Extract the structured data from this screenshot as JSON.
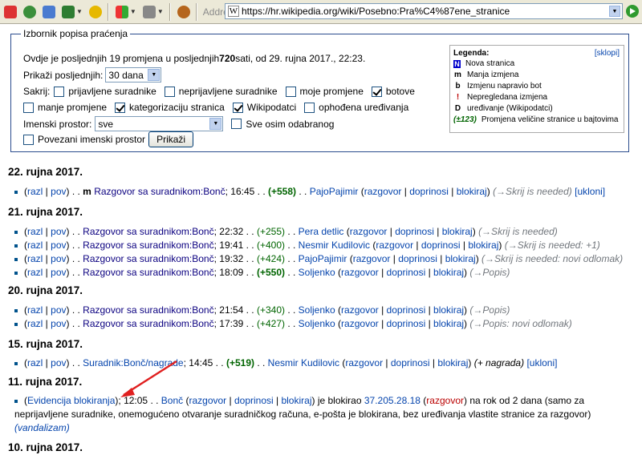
{
  "browser": {
    "address_label": "Address",
    "url": "https://hr.wikipedia.org/wiki/Posebno:Pra%C4%87ene_stranice"
  },
  "options": {
    "legend": "Izbornik popisa praćenja",
    "summary_pre": "Ovdje je posljednjih 19 promjena u posljednjih ",
    "summary_hours": "720",
    "summary_post": " sati, od 29. rujna 2017., 22:23.",
    "show_last_label": "Prikaži posljednjih:",
    "show_last_value": "30 dana",
    "hide_label": "Sakrij:",
    "cb_registered": "prijavljene suradnike",
    "cb_unregistered": "neprijavljene suradnike",
    "cb_mine": "moje promjene",
    "cb_bots": "botove",
    "cb_minor": "manje promjene",
    "cb_categorization": "kategorizaciju stranica",
    "cb_wikidata": "Wikipodatci",
    "cb_patrolled": "ophođena uređivanja",
    "namespace_label": "Imenski prostor:",
    "namespace_value": "sve",
    "invert_label": "Sve osim odabranog",
    "associated_label": "Povezani imenski prostor",
    "submit_label": "Prikaži"
  },
  "legend_box": {
    "title": "Legenda:",
    "hide": "[sklopi]",
    "items": [
      {
        "key": "N",
        "text": "Nova stranica"
      },
      {
        "key": "m",
        "text": "Manja izmjena"
      },
      {
        "key": "b",
        "text": "Izmjenu napravio bot"
      },
      {
        "key": "!",
        "text": "Nepregledana izmjena"
      },
      {
        "key": "D",
        "text": "uređivanje (Wikipodatci)"
      },
      {
        "key": "(±123)",
        "text": "Promjena veličine stranice u bajtovima"
      }
    ]
  },
  "days": [
    {
      "date": "22. rujna 2017."
    },
    {
      "date": "21. rujna 2017."
    },
    {
      "date": "20. rujna 2017."
    },
    {
      "date": "15. rujna 2017."
    },
    {
      "date": "11. rujna 2017."
    },
    {
      "date": "10. rujna 2017."
    }
  ],
  "links": {
    "razl": "razl",
    "pov": "pov",
    "razgovor": "razgovor",
    "doprinosi": "doprinosi",
    "blokiraj": "blokiraj",
    "ukloni": "ukloni",
    "page_talk": "Razgovor sa suradnikom:Bonč",
    "page_awards": "Suradnik:Bonč/nagrade"
  },
  "entries": [
    {
      "flag": "m",
      "time": "16:45",
      "size": "(+558)",
      "user": "PajoPajimir",
      "comment": "(→Skrij is needed)",
      "extra": "[ukloni]"
    },
    {
      "time": "22:32",
      "size": "(+255)",
      "user": "Pera detlic",
      "comment": "(→Skrij is needed)"
    },
    {
      "time": "19:41",
      "size": "(+400)",
      "user": "Nesmir Kudilovic",
      "comment": "(→Skrij is needed: +1)"
    },
    {
      "time": "19:32",
      "size": "(+424)",
      "user": "PajoPajimir",
      "comment": "(→Skrij is needed: novi odlomak)"
    },
    {
      "time": "18:09",
      "size": "(+550)",
      "user": "Soljenko",
      "comment": "(→Popis)"
    },
    {
      "time": "21:54",
      "size": "(+340)",
      "user": "Soljenko",
      "comment": "(→Popis)"
    },
    {
      "time": "17:39",
      "size": "(+427)",
      "user": "Soljenko",
      "comment": "(→Popis: novi odlomak)"
    },
    {
      "time": "14:45",
      "size": "(+519)",
      "user": "Nesmir Kudilovic",
      "comment": "(+ nagrada)",
      "extra": "[ukloni]"
    }
  ],
  "block": {
    "log": "Evidencija blokiranja",
    "time": "12:05",
    "user": "Bonč",
    "blocked_text": "je blokirao",
    "target": "37.205.28.18",
    "rest": "na rok od 2 dana (samo za neprijavljene suradnike, onemogućeno otvaranje suradničkog računa, e-pošta je blokirana, bez uređivanja vlastite stranice za razgovor)",
    "reason": "(vandalizam)"
  }
}
